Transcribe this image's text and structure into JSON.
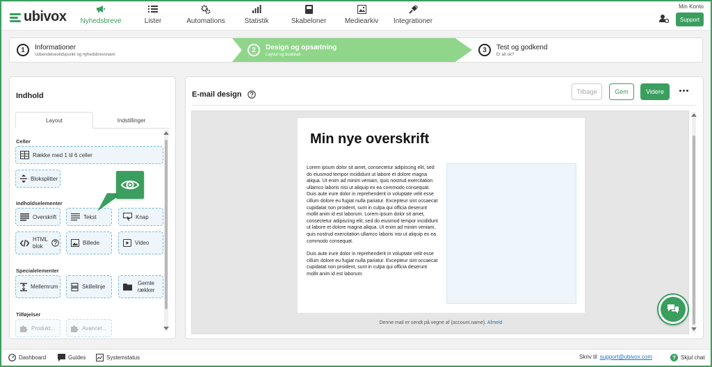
{
  "brand": {
    "name": "ubivox",
    "accent": "#3a9e5f"
  },
  "nav": {
    "items": [
      {
        "label": "Nyhedsbreve",
        "icon": "megaphone-icon",
        "active": true
      },
      {
        "label": "Lister",
        "icon": "list-icon"
      },
      {
        "label": "Automations",
        "icon": "gears-icon"
      },
      {
        "label": "Statistik",
        "icon": "bar-chart-icon"
      },
      {
        "label": "Skabeloner",
        "icon": "template-icon"
      },
      {
        "label": "Mediearkiv",
        "icon": "image-icon"
      },
      {
        "label": "Integrationer",
        "icon": "plug-icon"
      }
    ],
    "account": "Min Konto",
    "support": "Support"
  },
  "stepper": {
    "steps": [
      {
        "num": "1",
        "title": "Informationer",
        "sub": "Udsendelsestidspunkt og nyhedsbrevsnavn"
      },
      {
        "num": "2",
        "title": "Design og opsætning",
        "sub": "Layout og budskab",
        "active": true
      },
      {
        "num": "3",
        "title": "Test og godkend",
        "sub": "Er alt ok?"
      }
    ]
  },
  "left": {
    "title": "Indhold",
    "tabs": [
      "Layout",
      "Indstillinger"
    ],
    "sections": {
      "cells": "Celler",
      "content": "Indholdselementer",
      "special": "Specialelementer",
      "addons": "Tilføjelser"
    },
    "elements": {
      "row": "Række med 1 til 6 celler",
      "splitter": "Bloksplitter",
      "heading": "Overskrift",
      "text": "Tekst",
      "button": "Knap",
      "html": "HTML blok",
      "image": "Billede",
      "video": "Video",
      "spacer": "Mellemrum",
      "divider": "Skillelinje",
      "saved": "Gemte rækker",
      "product": "Produkt...",
      "advanced": "Avancer..."
    }
  },
  "main": {
    "title": "E-mail design",
    "back": "Tilbage",
    "save": "Gem",
    "next": "Videre",
    "email": {
      "heading": "Min nye overskrift",
      "para1": "Lorem ipsum dolor sit amet, consectetur adipiscing elit, sed do eiusmod tempor incididunt ut labore et dolore magna aliqua. Ut enim ad minim veniam, quis nostrud exercitation ullamco laboris nisi ut aliquip ex ea commodo consequat. Duis aute irure dolor in reprehenderit in voluptate velit esse cillum dolore eu fugiat nulla pariatur. Excepteur sint occaecat cupidatat non proident, sunt in culpa qui officia deserunt mollit anim id est laborum. Lorem ipsum dolor sit amet, consectetur adipiscing elit, sed do eiusmod tempor incididunt ut labore et dolore magna aliqua. Ut enim ad minim veniam, quis nostrud exercitation ullamco laboris nisi ut aliquip ex ea commodo consequat.",
      "para2": "Duis aute irure dolor in reprehenderit in voluptate velit esse cillum dolore eu fugiat nulla pariatur. Excepteur sint occaecat cupidatat non proident, sunt in culpa qui officia deserunt mollit anim id est laborum.",
      "footer_text": "Denne mail er sendt på vegne af {account.name}.",
      "footer_link": "Afmeld"
    }
  },
  "bottom": {
    "dashboard": "Dashboard",
    "guides": "Guides",
    "status": "Systemstatus",
    "write_to": "Skriv til",
    "email": "support@ubivox.com",
    "hide_chat": "Skjul chat"
  }
}
